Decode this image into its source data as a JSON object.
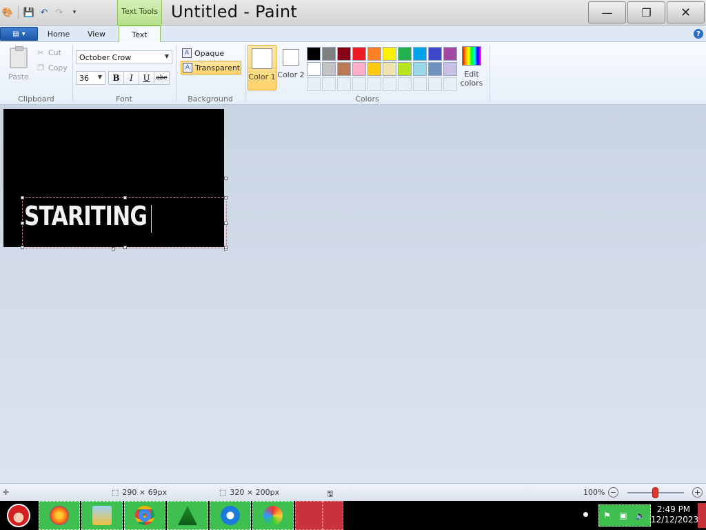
{
  "window": {
    "title": "Untitled - Paint",
    "context_tab": "Text Tools",
    "minimize": "—",
    "restore": "❐",
    "close": "✕"
  },
  "tabs": [
    {
      "label": "Home"
    },
    {
      "label": "View"
    },
    {
      "label": "Text"
    }
  ],
  "help": "?",
  "clipboard": {
    "label": "Clipboard",
    "paste": "Paste",
    "cut": "Cut",
    "copy": "Copy"
  },
  "font": {
    "label": "Font",
    "family": "October Crow",
    "size": "36",
    "bold": "B",
    "italic": "I",
    "underline": "U",
    "strikethrough": "abc"
  },
  "background": {
    "label": "Background",
    "opaque": "Opaque",
    "transparent": "Transparent",
    "selected": "Transparent"
  },
  "colors": {
    "label": "Colors",
    "color1": "Color 1",
    "color2": "Color 2",
    "edit": "Edit colors",
    "color1_value": "#ffffff",
    "color2_value": "#ffffff",
    "palette": [
      "#000000",
      "#7f7f7f",
      "#880015",
      "#ed1c24",
      "#ff7f27",
      "#fff200",
      "#22b14c",
      "#00a2e8",
      "#3f48cc",
      "#a349a4",
      "#ffffff",
      "#c3c3c3",
      "#b97a57",
      "#ffaec9",
      "#ffc90e",
      "#efe4b0",
      "#b5e61d",
      "#99d9ea",
      "#7092be",
      "#c8bfe7",
      "",
      "",
      "",
      "",
      "",
      "",
      "",
      "",
      "",
      ""
    ]
  },
  "canvas": {
    "typed_text": "STARITING",
    "background": "#000000"
  },
  "status": {
    "selection_size": "290 × 69px",
    "canvas_size": "320 × 200px",
    "zoom": "100%",
    "zoom_minus": "−",
    "zoom_plus": "+"
  },
  "taskbar": {
    "time": "2:49 PM",
    "date": "12/12/2023"
  }
}
